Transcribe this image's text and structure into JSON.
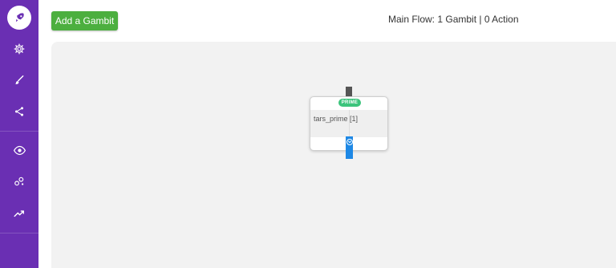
{
  "sidebar": {
    "items": [
      {
        "icon": "rocket-icon"
      },
      {
        "icon": "gear-icon"
      },
      {
        "icon": "brush-icon"
      },
      {
        "icon": "share-icon"
      },
      {
        "icon": "eye-icon"
      },
      {
        "icon": "nodes-icon"
      },
      {
        "icon": "trend-icon"
      }
    ]
  },
  "toolbar": {
    "add_gambit_label": "Add a Gambit",
    "flow_status": "Main Flow: 1 Gambit | 0 Action"
  },
  "node": {
    "badge": "PRIME",
    "label": "tars_prime [1]"
  },
  "colors": {
    "sidebar": "#6a2fb3",
    "add_button": "#4caf3f",
    "prime_badge": "#3cc47c",
    "handle": "#1e88e5"
  }
}
